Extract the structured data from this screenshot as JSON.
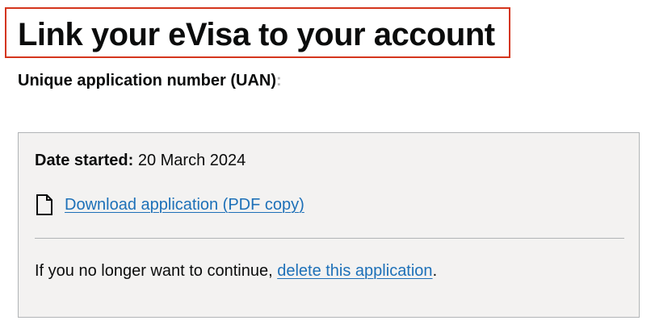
{
  "header": {
    "title": "Link your eVisa to your account"
  },
  "application": {
    "uan_label": "Unique application number (UAN)",
    "uan_colon": ":"
  },
  "summary": {
    "date_label": "Date started:",
    "date_value": "20 March 2024",
    "download_icon": "file-icon",
    "download_link": "Download application (PDF copy)",
    "continue_prefix": "If you no longer want to continue,",
    "delete_link": "delete this application",
    "continue_suffix": "."
  },
  "colors": {
    "text": "#0b0c0c",
    "link": "#1d70b8",
    "panel_background": "#f3f2f1",
    "panel_border": "#b1b4b6",
    "highlight_border": "#d4351c"
  }
}
